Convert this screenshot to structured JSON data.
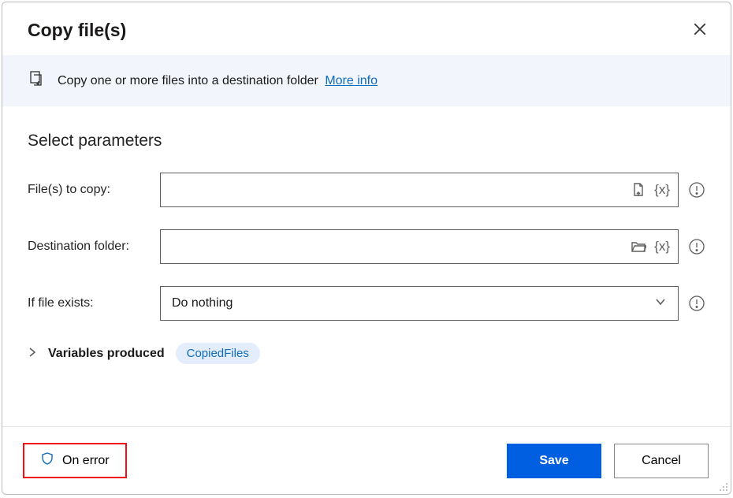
{
  "header": {
    "title": "Copy file(s)"
  },
  "info": {
    "text": "Copy one or more files into a destination folder",
    "more_label": "More info"
  },
  "section": {
    "heading": "Select parameters"
  },
  "fields": {
    "files_to_copy": {
      "label": "File(s) to copy:",
      "value": ""
    },
    "destination_folder": {
      "label": "Destination folder:",
      "value": ""
    },
    "if_file_exists": {
      "label": "If file exists:",
      "value": "Do nothing"
    }
  },
  "variables": {
    "label": "Variables produced",
    "chip": "CopiedFiles"
  },
  "footer": {
    "on_error": "On error",
    "save": "Save",
    "cancel": "Cancel"
  }
}
